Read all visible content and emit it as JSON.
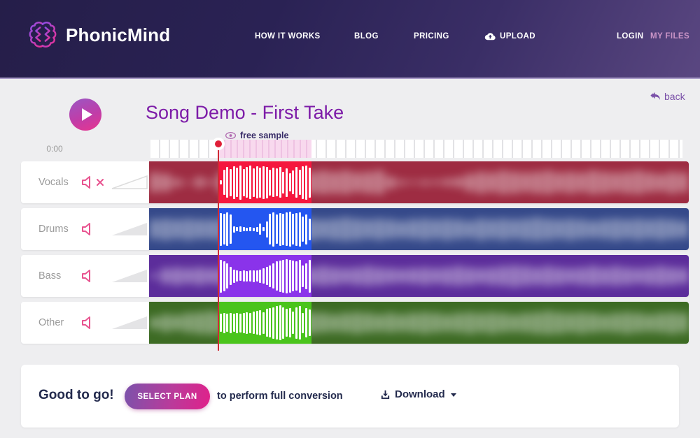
{
  "header": {
    "brand": "PhonicMind",
    "nav": {
      "how_it_works": "HOW IT WORKS",
      "blog": "BLOG",
      "pricing": "PRICING",
      "upload": "UPLOAD"
    },
    "login": "LOGIN",
    "my_files": "MY FILES"
  },
  "page": {
    "back": "back",
    "title": "Song Demo - First Take",
    "free_sample": "free sample",
    "time_current": "0:00"
  },
  "footer": {
    "status": "Good to go!",
    "select_plan": "SELECT PLAN",
    "note": "to perform full conversion",
    "download": "Download"
  },
  "colors": {
    "header_dark": "#251e49",
    "header_light": "#5a4781",
    "title_purple": "#7d1ca8",
    "back_purple": "#7a50a8",
    "my_files_pink": "#c994c6",
    "playhead_red": "#e02038",
    "speaker_pink": "#e8538f",
    "button_gradient_start": "#7b52ab",
    "button_gradient_end": "#e0218a",
    "text_dark": "#232a4d"
  },
  "icons": {
    "logo": "brain-icon",
    "upload": "cloud-upload-icon",
    "back": "reply-arrow-icon",
    "play": "play-icon",
    "free_sample": "eye-icon",
    "mute": "speaker-muted-icon",
    "volume": "speaker-icon",
    "download": "download-icon",
    "caret": "caret-down-icon"
  },
  "tracks": [
    {
      "name": "Vocals",
      "muted": true,
      "colors": {
        "base": "#9e2c42",
        "active": "#f5173e"
      },
      "sample_bars": [
        0.12,
        0.7,
        0.85,
        0.75,
        0.9,
        0.8,
        0.95,
        0.75,
        0.85,
        0.92,
        0.78,
        0.88,
        0.82,
        0.9,
        0.86,
        0.72,
        0.8,
        0.76,
        0.84,
        0.6,
        0.78,
        0.5,
        0.66,
        0.84,
        0.7,
        0.9,
        0.95,
        0.82
      ],
      "bg_bars": [
        0.5,
        0.45,
        0.2,
        0.05,
        0.25,
        0.1,
        0.5,
        0.5,
        0.5,
        0.5,
        0.5,
        0.5,
        0.5,
        0.5,
        0.55,
        0.6,
        0.55,
        0.6,
        0.5,
        0.55,
        0.6,
        0.3,
        0.12,
        0.08,
        0.12,
        0.1,
        0.18,
        0.25,
        0.45,
        0.55,
        0.5,
        0.6,
        0.55,
        0.5,
        0.55,
        0.6,
        0.5,
        0.55,
        0.5,
        0.6,
        0.55,
        0.5,
        0.55,
        0.6,
        0.5,
        0.45,
        0.55,
        0.5
      ]
    },
    {
      "name": "Drums",
      "muted": false,
      "colors": {
        "base": "#35498a",
        "active": "#2456f0"
      },
      "sample_bars": [
        0.9,
        0.85,
        0.92,
        0.8,
        0.18,
        0.12,
        0.15,
        0.12,
        0.1,
        0.12,
        0.1,
        0.14,
        0.3,
        0.12,
        0.45,
        0.85,
        0.95,
        0.8,
        0.9,
        0.86,
        0.92,
        0.96,
        0.85,
        0.9,
        0.95,
        0.7,
        0.82,
        0.6
      ],
      "bg_bars": [
        0.5,
        0.55,
        0.5,
        0.55,
        0.5,
        0.5,
        0.55,
        0.5,
        0.5,
        0.5,
        0.5,
        0.5,
        0.5,
        0.5,
        0.55,
        0.5,
        0.55,
        0.6,
        0.55,
        0.5,
        0.55,
        0.5,
        0.45,
        0.5,
        0.55,
        0.5,
        0.55,
        0.5,
        0.45,
        0.55,
        0.5,
        0.55,
        0.5,
        0.55,
        0.6,
        0.55,
        0.5,
        0.55,
        0.5,
        0.45,
        0.5,
        0.55,
        0.5,
        0.55,
        0.5,
        0.55,
        0.5,
        0.45
      ]
    },
    {
      "name": "Bass",
      "muted": false,
      "colors": {
        "base": "#5c2d9b",
        "active": "#8a33ea"
      },
      "sample_bars": [
        0.9,
        0.82,
        0.7,
        0.5,
        0.36,
        0.3,
        0.26,
        0.3,
        0.28,
        0.3,
        0.32,
        0.3,
        0.36,
        0.42,
        0.5,
        0.6,
        0.7,
        0.8,
        0.86,
        0.9,
        0.95,
        0.9,
        0.85,
        0.8,
        0.9,
        0.6,
        0.72,
        0.9
      ],
      "bg_bars": [
        0.1,
        0.4,
        0.45,
        0.4,
        0.45,
        0.4,
        0.45,
        0.4,
        0.4,
        0.4,
        0.4,
        0.4,
        0.4,
        0.4,
        0.45,
        0.5,
        0.45,
        0.4,
        0.45,
        0.5,
        0.45,
        0.4,
        0.35,
        0.4,
        0.45,
        0.4,
        0.45,
        0.5,
        0.45,
        0.4,
        0.45,
        0.5,
        0.55,
        0.5,
        0.45,
        0.5,
        0.45,
        0.4,
        0.45,
        0.5,
        0.45,
        0.5,
        0.45,
        0.4,
        0.45,
        0.5,
        0.45,
        0.4
      ]
    },
    {
      "name": "Other",
      "muted": false,
      "colors": {
        "base": "#3d6b24",
        "active": "#4ac41c"
      },
      "sample_bars": [
        0.5,
        0.55,
        0.5,
        0.56,
        0.5,
        0.55,
        0.52,
        0.56,
        0.6,
        0.55,
        0.62,
        0.66,
        0.7,
        0.6,
        0.76,
        0.8,
        0.86,
        0.92,
        0.96,
        0.86,
        0.76,
        0.8,
        0.62,
        0.86,
        0.92,
        0.55,
        0.8,
        0.74
      ],
      "bg_bars": [
        0.3,
        0.45,
        0.4,
        0.5,
        0.55,
        0.6,
        0.55,
        0.5,
        0.5,
        0.5,
        0.5,
        0.5,
        0.5,
        0.5,
        0.55,
        0.5,
        0.45,
        0.5,
        0.55,
        0.5,
        0.45,
        0.5,
        0.45,
        0.5,
        0.55,
        0.5,
        0.45,
        0.5,
        0.55,
        0.5,
        0.55,
        0.5,
        0.45,
        0.5,
        0.55,
        0.6,
        0.55,
        0.5,
        0.55,
        0.5,
        0.45,
        0.5,
        0.55,
        0.5,
        0.45,
        0.5,
        0.55,
        0.5
      ]
    }
  ]
}
